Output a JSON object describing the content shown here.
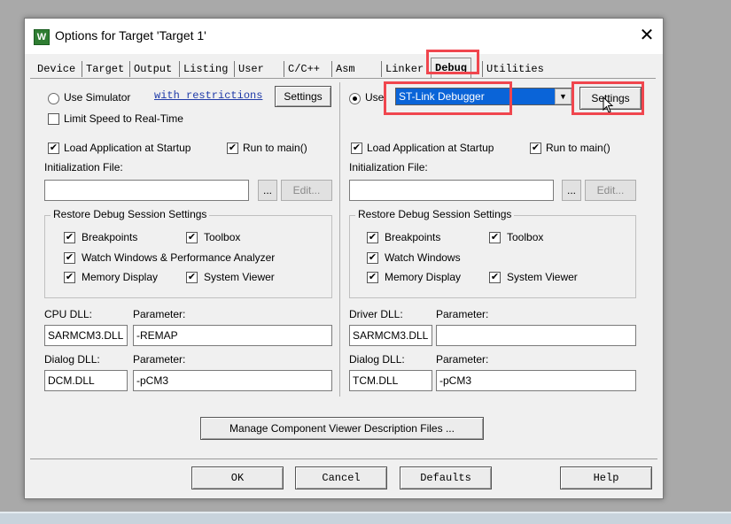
{
  "window": {
    "title": "Options for Target 'Target 1'",
    "app_icon": "W",
    "close": "✕"
  },
  "tabs": [
    "Device",
    "Target",
    "Output",
    "Listing",
    "User",
    "C/C++",
    "Asm",
    "Linker",
    "Debug",
    "Utilities"
  ],
  "left": {
    "use_simulator": "Use Simulator",
    "with_restrictions": "with restrictions",
    "settings": "Settings",
    "limit_speed": "Limit Speed to Real-Time",
    "load_app": "Load Application at Startup",
    "run_to_main": "Run to main()",
    "init_file": "Initialization File:",
    "browse": "...",
    "edit": "Edit...",
    "restore_title": "Restore Debug Session Settings",
    "breakpoints": "Breakpoints",
    "toolbox": "Toolbox",
    "watch_windows": "Watch Windows & Performance Analyzer",
    "memory_display": "Memory Display",
    "system_viewer": "System Viewer",
    "cpu_dll_label": "CPU DLL:",
    "parameter_label": "Parameter:",
    "cpu_dll": "SARMCM3.DLL",
    "cpu_param": "-REMAP",
    "dialog_dll_label": "Dialog DLL:",
    "dialog_dll": "DCM.DLL",
    "dialog_param": "-pCM3"
  },
  "right": {
    "use": "Use:",
    "debugger": "ST-Link Debugger",
    "settings": "Settings",
    "load_app": "Load Application at Startup",
    "run_to_main": "Run to main()",
    "init_file": "Initialization File:",
    "browse": "...",
    "edit": "Edit...",
    "restore_title": "Restore Debug Session Settings",
    "breakpoints": "Breakpoints",
    "toolbox": "Toolbox",
    "watch_windows": "Watch Windows",
    "memory_display": "Memory Display",
    "system_viewer": "System Viewer",
    "driver_dll_label": "Driver DLL:",
    "parameter_label": "Parameter:",
    "driver_dll": "SARMCM3.DLL",
    "driver_param": "",
    "dialog_dll_label": "Dialog DLL:",
    "dialog_dll": "TCM.DLL",
    "dialog_param": "-pCM3"
  },
  "manage_button": "Manage Component Viewer Description Files ...",
  "footer": {
    "ok": "OK",
    "cancel": "Cancel",
    "defaults": "Defaults",
    "help": "Help"
  },
  "check_mark": "✔",
  "dropdown_arrow": "▼",
  "icons": [
    "app-icon",
    "close-icon",
    "dropdown-arrow-icon",
    "cursor-icon"
  ]
}
